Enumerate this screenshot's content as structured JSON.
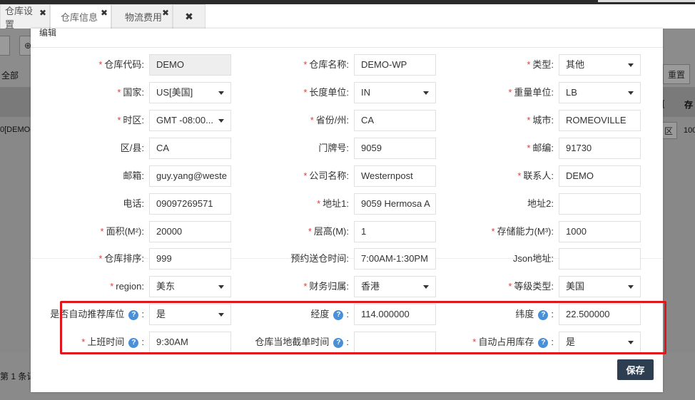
{
  "tabs": [
    {
      "label": "仓库设置",
      "close": "✖"
    },
    {
      "label": "仓库信息",
      "close": "✖"
    },
    {
      "label": "物流费用",
      "close": "✖"
    },
    {
      "label": "",
      "close": "✖"
    }
  ],
  "background": {
    "select_all": "全部",
    "reset": "重置",
    "row_code": "0[DEMO-",
    "col_store": "存",
    "col_partial": "区",
    "col_num": "100",
    "pager": "第 1 条记",
    "bracket": "["
  },
  "modal": {
    "title": "编辑",
    "help_symbol": "?",
    "colon": ":",
    "save_label": "保存",
    "fields": {
      "warehouse_code": {
        "label": "仓库代码:",
        "required": true,
        "value": "DEMO"
      },
      "warehouse_name": {
        "label": "仓库名称:",
        "required": true,
        "value": "DEMO-WP"
      },
      "type": {
        "label": "类型:",
        "required": true,
        "value": "其他"
      },
      "country": {
        "label": "国家:",
        "required": true,
        "value": "US[美国]"
      },
      "length_unit": {
        "label": "长度单位:",
        "required": true,
        "value": "IN"
      },
      "weight_unit": {
        "label": "重量单位:",
        "required": true,
        "value": "LB"
      },
      "timezone": {
        "label": "时区:",
        "required": true,
        "value": "GMT -08:00..."
      },
      "province": {
        "label": "省份/州:",
        "required": true,
        "value": "CA"
      },
      "city": {
        "label": "城市:",
        "required": true,
        "value": "ROMEOVILLE"
      },
      "district": {
        "label": "区/县:",
        "required": false,
        "value": "CA"
      },
      "house_number": {
        "label": "门牌号:",
        "required": false,
        "value": "9059"
      },
      "postcode": {
        "label": "邮编:",
        "required": true,
        "value": "91730"
      },
      "email": {
        "label": "邮箱:",
        "required": false,
        "value": "guy.yang@weste"
      },
      "company": {
        "label": "公司名称:",
        "required": true,
        "value": "Westernpost"
      },
      "contact": {
        "label": "联系人:",
        "required": true,
        "value": "DEMO"
      },
      "phone": {
        "label": "电话:",
        "required": false,
        "value": "09097269571"
      },
      "address1": {
        "label": "地址1:",
        "required": true,
        "value": "9059 Hermosa A"
      },
      "address2": {
        "label": "地址2:",
        "required": false,
        "value": ""
      },
      "area": {
        "label": "面积(M²):",
        "required": true,
        "value": "20000"
      },
      "floor_height": {
        "label": "层高(M):",
        "required": true,
        "value": "1"
      },
      "capacity": {
        "label": "存储能力(M³):",
        "required": true,
        "value": "1000"
      },
      "sort": {
        "label": "仓库排序:",
        "required": true,
        "value": "999"
      },
      "delivery_time": {
        "label": "预约送仓时间:",
        "required": false,
        "value": "7:00AM-1:30PM"
      },
      "json_addr": {
        "label": "Json地址:",
        "required": false,
        "value": ""
      },
      "region": {
        "label": "region:",
        "required": true,
        "value": "美东"
      },
      "finance": {
        "label": "财务归属:",
        "required": true,
        "value": "香港"
      },
      "grade_type": {
        "label": "等级类型:",
        "required": true,
        "value": "美国"
      },
      "auto_recommend": {
        "label": "是否自动推荐库位",
        "required": false,
        "value": "是"
      },
      "longitude": {
        "label": "经度",
        "required": false,
        "value": "114.000000"
      },
      "latitude": {
        "label": "纬度",
        "required": false,
        "value": "22.500000"
      },
      "work_time": {
        "label": "上班时间",
        "required": true,
        "value": "9:30AM"
      },
      "cutoff_time": {
        "label": "仓库当地截单时间",
        "required": false,
        "value": ""
      },
      "auto_occupy": {
        "label": "自动占用库存",
        "required": true,
        "value": "是"
      }
    }
  }
}
